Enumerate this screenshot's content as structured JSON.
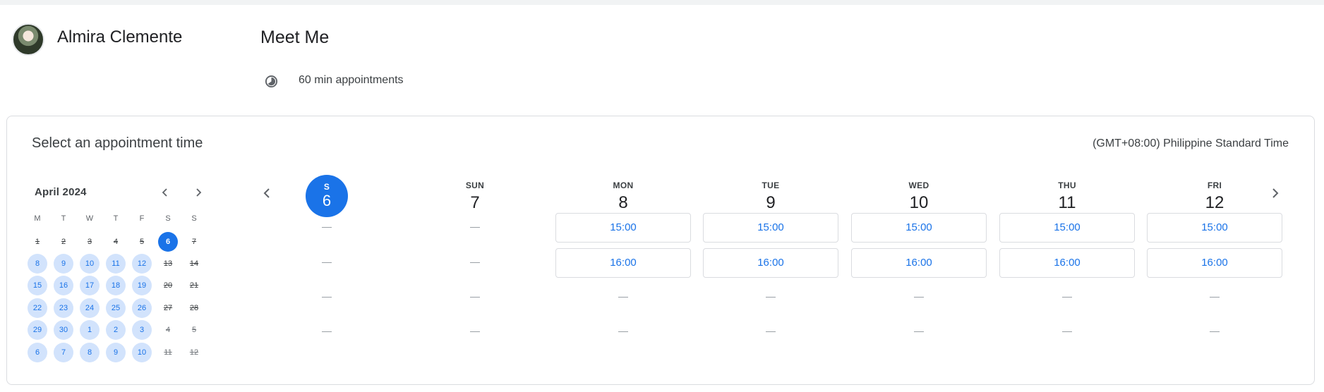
{
  "host": {
    "name": "Almira Clemente"
  },
  "event": {
    "title": "Meet Me",
    "duration": "60 min appointments"
  },
  "panel": {
    "title": "Select an appointment time",
    "timezone": "(GMT+08:00) Philippine Standard Time"
  },
  "mini_calendar": {
    "month": "April 2024",
    "weekdays": [
      "M",
      "T",
      "W",
      "T",
      "F",
      "S",
      "S"
    ],
    "weeks": [
      [
        {
          "d": "1",
          "s": "past"
        },
        {
          "d": "2",
          "s": "past"
        },
        {
          "d": "3",
          "s": "past"
        },
        {
          "d": "4",
          "s": "past"
        },
        {
          "d": "5",
          "s": "past"
        },
        {
          "d": "6",
          "s": "selected"
        },
        {
          "d": "7",
          "s": "unavailable"
        }
      ],
      [
        {
          "d": "8",
          "s": "available"
        },
        {
          "d": "9",
          "s": "available"
        },
        {
          "d": "10",
          "s": "available"
        },
        {
          "d": "11",
          "s": "available"
        },
        {
          "d": "12",
          "s": "available"
        },
        {
          "d": "13",
          "s": "unavailable"
        },
        {
          "d": "14",
          "s": "unavailable"
        }
      ],
      [
        {
          "d": "15",
          "s": "available"
        },
        {
          "d": "16",
          "s": "available"
        },
        {
          "d": "17",
          "s": "available"
        },
        {
          "d": "18",
          "s": "available"
        },
        {
          "d": "19",
          "s": "available"
        },
        {
          "d": "20",
          "s": "unavailable"
        },
        {
          "d": "21",
          "s": "unavailable"
        }
      ],
      [
        {
          "d": "22",
          "s": "available"
        },
        {
          "d": "23",
          "s": "available"
        },
        {
          "d": "24",
          "s": "available"
        },
        {
          "d": "25",
          "s": "available"
        },
        {
          "d": "26",
          "s": "available"
        },
        {
          "d": "27",
          "s": "unavailable"
        },
        {
          "d": "28",
          "s": "unavailable"
        }
      ],
      [
        {
          "d": "29",
          "s": "available"
        },
        {
          "d": "30",
          "s": "available"
        },
        {
          "d": "1",
          "s": "available"
        },
        {
          "d": "2",
          "s": "available"
        },
        {
          "d": "3",
          "s": "available"
        },
        {
          "d": "4",
          "s": "other-unavailable"
        },
        {
          "d": "5",
          "s": "other-unavailable"
        }
      ],
      [
        {
          "d": "6",
          "s": "available"
        },
        {
          "d": "7",
          "s": "available"
        },
        {
          "d": "8",
          "s": "available"
        },
        {
          "d": "9",
          "s": "available"
        },
        {
          "d": "10",
          "s": "available"
        },
        {
          "d": "11",
          "s": "other-unavailable"
        },
        {
          "d": "12",
          "s": "other-unavailable"
        }
      ]
    ]
  },
  "week": {
    "days": [
      {
        "dow": "S",
        "num": "6",
        "today": true,
        "slots": [
          "",
          "",
          "",
          ""
        ]
      },
      {
        "dow": "SUN",
        "num": "7",
        "slots": [
          "",
          "",
          "",
          ""
        ]
      },
      {
        "dow": "MON",
        "num": "8",
        "slots": [
          "15:00",
          "16:00",
          "",
          ""
        ]
      },
      {
        "dow": "TUE",
        "num": "9",
        "slots": [
          "15:00",
          "16:00",
          "",
          ""
        ]
      },
      {
        "dow": "WED",
        "num": "10",
        "slots": [
          "15:00",
          "16:00",
          "",
          ""
        ]
      },
      {
        "dow": "THU",
        "num": "11",
        "slots": [
          "15:00",
          "16:00",
          "",
          ""
        ]
      },
      {
        "dow": "FRI",
        "num": "12",
        "slots": [
          "15:00",
          "16:00",
          "",
          ""
        ]
      }
    ]
  },
  "icons": {
    "prev": "chevron-left-icon",
    "next": "chevron-right-icon",
    "duration": "clock-icon"
  },
  "colors": {
    "accent": "#1a73e8",
    "available_bg": "#d2e3fc"
  }
}
